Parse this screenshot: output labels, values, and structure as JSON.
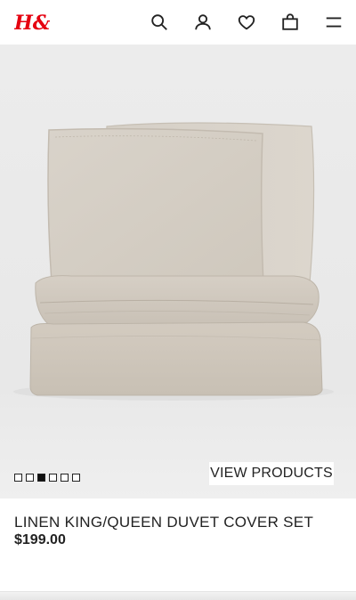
{
  "header": {
    "logo_text": "H&M",
    "brand_color": "#e50010",
    "icons": [
      "search-icon",
      "account-icon",
      "heart-icon",
      "bag-icon",
      "menu-icon"
    ]
  },
  "hero": {
    "image_subject": "linen duvet cover set with pillows",
    "slide_count": 6,
    "active_slide": 3,
    "cta_label": "VIEW PRODUCTS"
  },
  "product": {
    "title": "LINEN KING/QUEEN DUVET COVER SET",
    "price": "$199.00"
  }
}
